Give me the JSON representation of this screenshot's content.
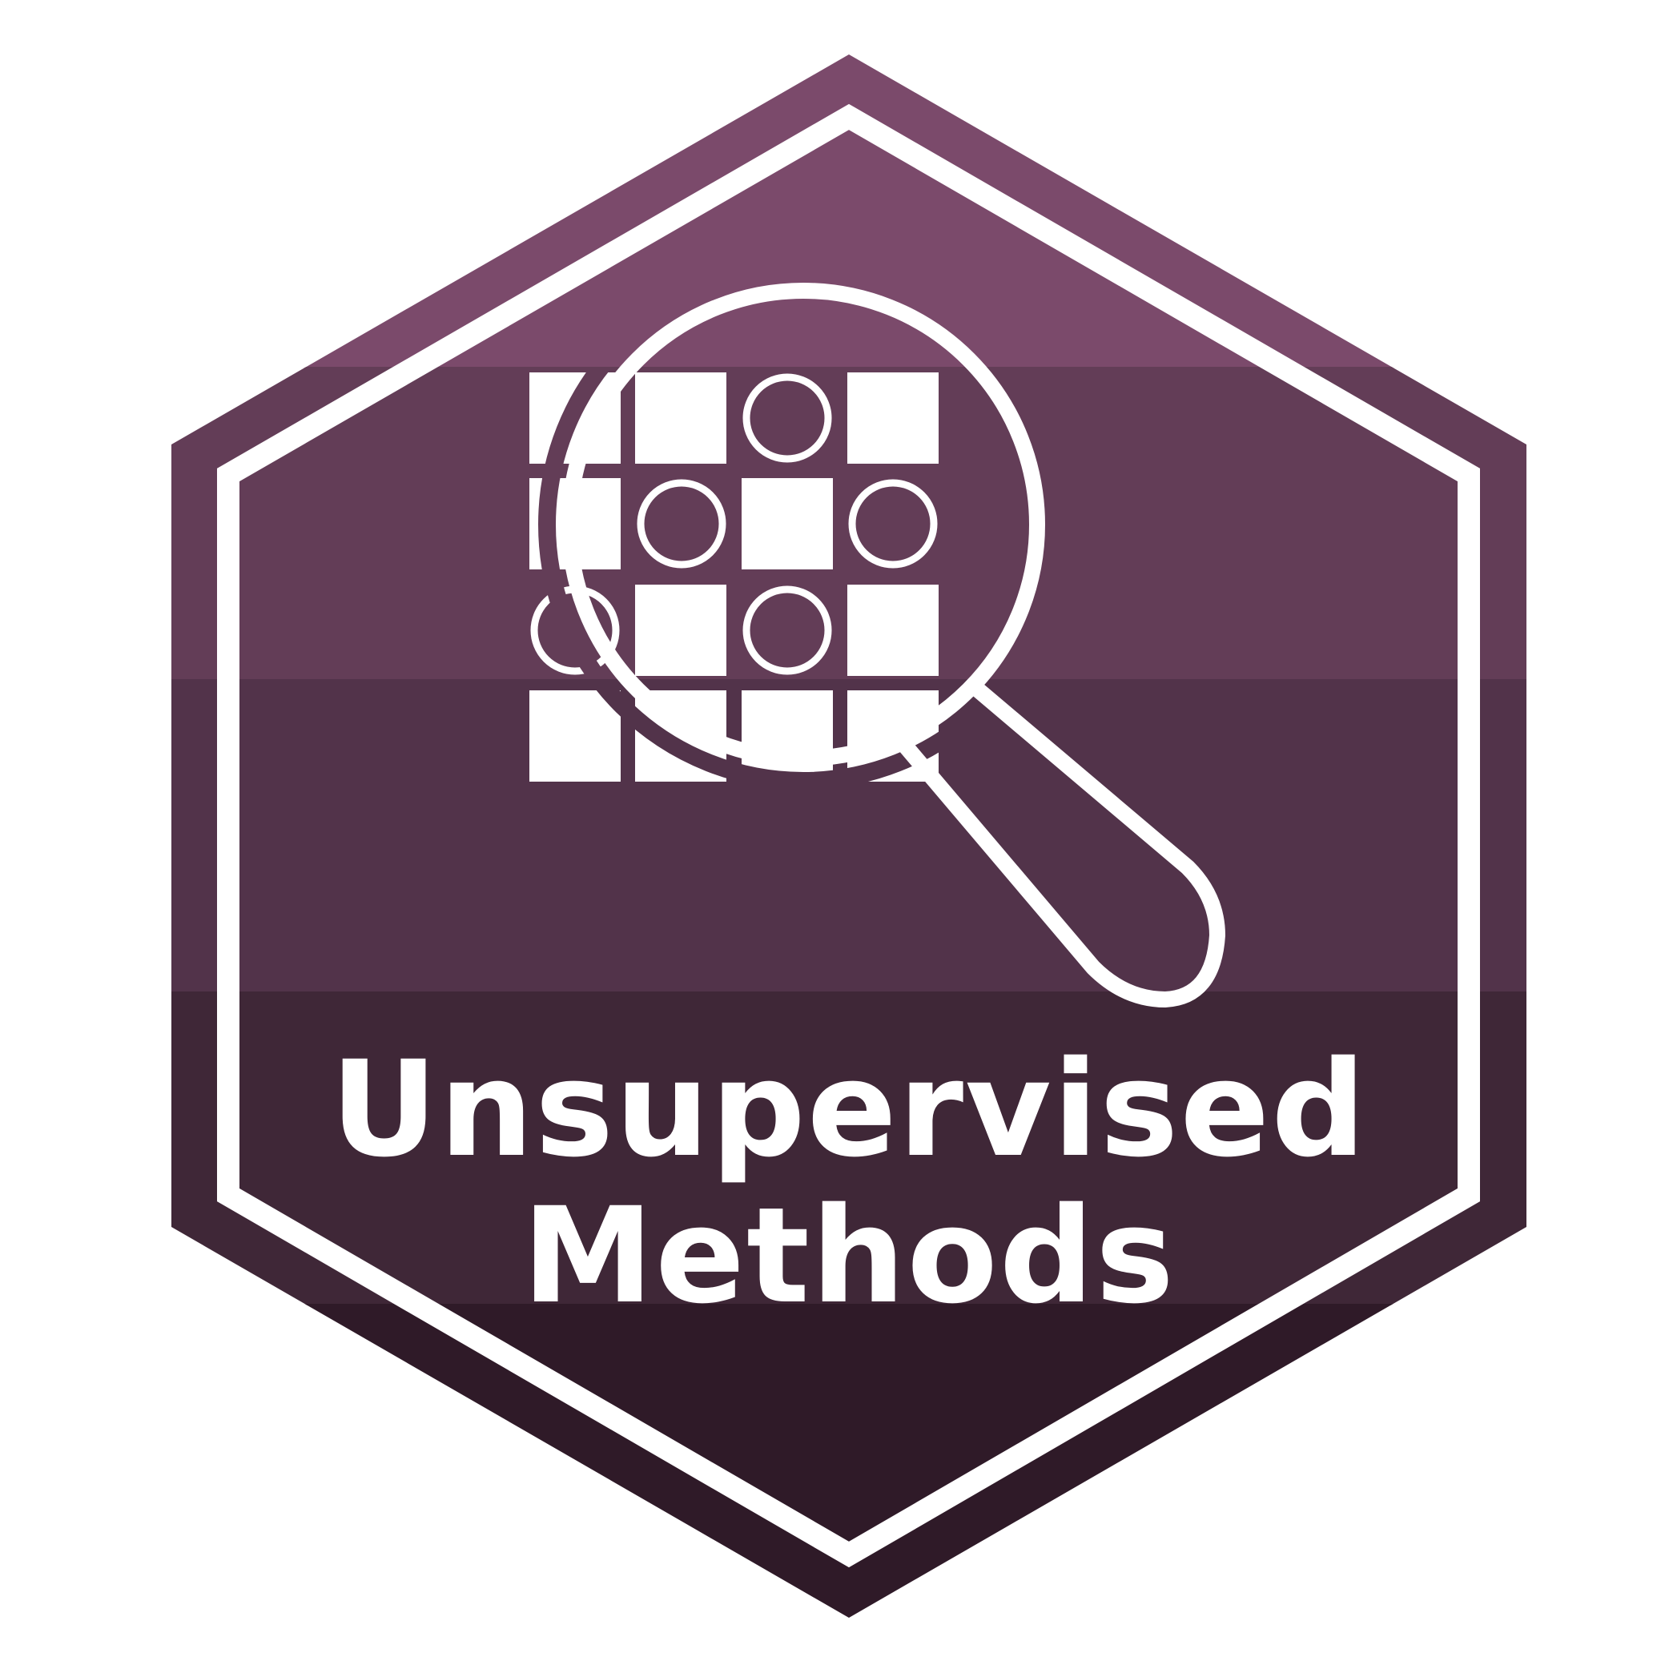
{
  "badge": {
    "title_line1": "Unsupervised",
    "title_line2": "Methods",
    "icon": "magnifying-glass-over-grid-icon",
    "colors": {
      "band1": "#7b4a6b",
      "band2": "#633d57",
      "band3": "#52334a",
      "band4": "#3f2737",
      "band5": "#2f1a28",
      "outline": "#ffffff"
    }
  }
}
